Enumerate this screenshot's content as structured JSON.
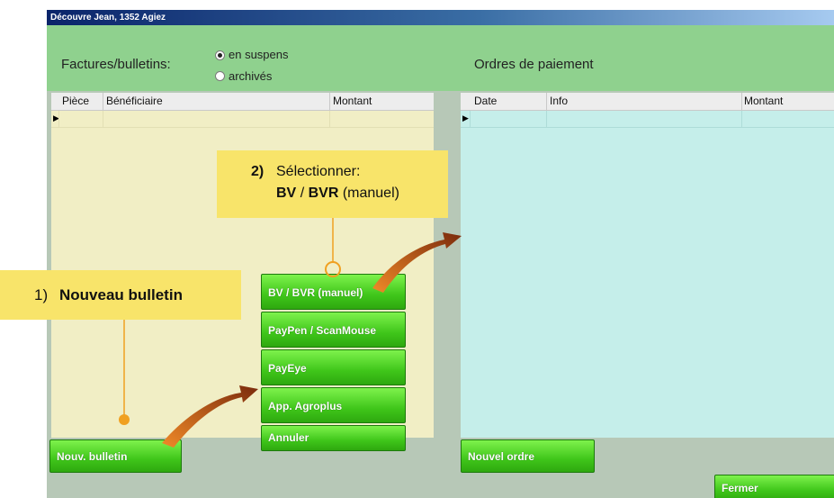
{
  "window": {
    "title": "Découvre Jean, 1352 Agiez"
  },
  "left_panel": {
    "label": "Factures/bulletins:",
    "radio_options": [
      "en suspens",
      "archivés"
    ],
    "selected_option": "en suspens",
    "columns": [
      "Pièce",
      "Bénéficiaire",
      "Montant"
    ],
    "new_button": "Nouv. bulletin"
  },
  "right_panel": {
    "label": "Ordres de paiement",
    "columns": [
      "Date",
      "Info",
      "Montant"
    ],
    "new_button": "Nouvel ordre"
  },
  "menu": {
    "items": [
      "BV / BVR (manuel)",
      "PayPen / ScanMouse",
      "PayEye",
      "App. Agroplus",
      "Annuler"
    ]
  },
  "close_button": "Fermer",
  "callouts": {
    "step1": {
      "num": "1)",
      "text": "Nouveau bulletin"
    },
    "step2": {
      "num": "2)",
      "line1": "Sélectionner:",
      "bold1": "BV",
      "sep": "/",
      "bold2": "BVR",
      "rest": "(manuel)"
    }
  },
  "colors": {
    "header_green": "#8fd18e",
    "left_list_bg": "#f1eec5",
    "right_list_bg": "#c5eeea",
    "button_green": "#3fc61a",
    "callout_yellow": "#f8e46a",
    "connector_orange": "#f0a020",
    "arrow_brown": "#8a3010"
  }
}
